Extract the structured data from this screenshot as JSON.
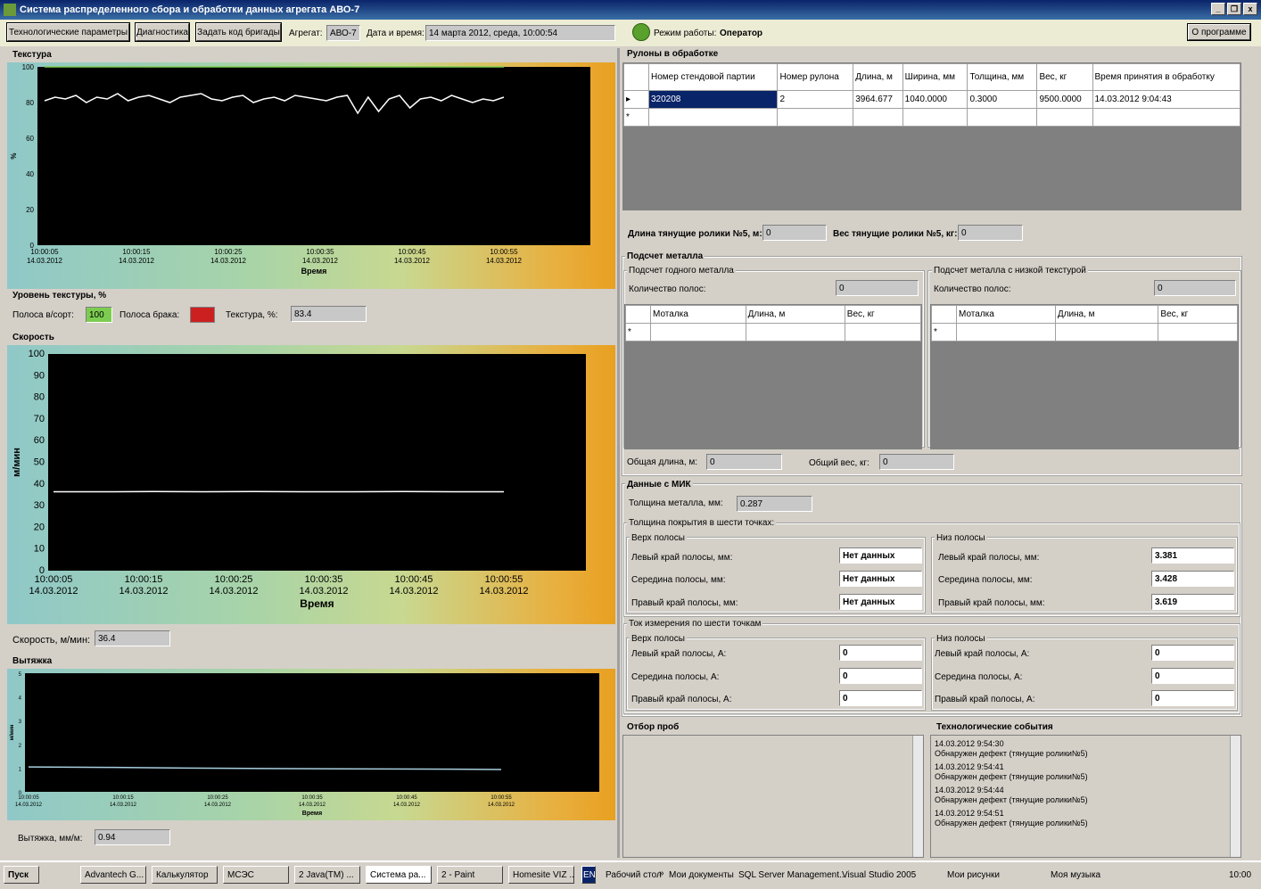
{
  "window": {
    "title": "Система распределенного сбора и обработки данных агрегата АВО-7",
    "min": "_",
    "max": "❒",
    "close": "x"
  },
  "toolbar": {
    "tech_params": "Технологические параметры",
    "diagnostics": "Диагностика",
    "brigade": "Задать код бригады",
    "aggregate_label": "Агрегат:",
    "aggregate_value": "АВО-7",
    "datetime_label": "Дата и время:",
    "datetime_value": "14 марта 2012, среда, 10:00:54",
    "mode_label": "Режим работы:",
    "mode_value": "Оператор",
    "about": "О программе"
  },
  "texture": {
    "title": "Текстура",
    "ylabel": "%",
    "xlabel": "Время",
    "level_title": "Уровень текстуры, %",
    "strip_grade_label": "Полоса в/сорт:",
    "strip_grade_value": "100",
    "defect_label": "Полоса брака:",
    "texture_label": "Текстура, %:",
    "texture_value": "83.4"
  },
  "speed": {
    "title": "Скорость",
    "ylabel": "м/мин",
    "xlabel": "Время",
    "speed_label": "Скорость, м/мин:",
    "speed_value": "36.4"
  },
  "stretch": {
    "title": "Вытяжка",
    "ylabel": "м/мин",
    "xlabel": "Время",
    "stretch_label": "Вытяжка, мм/м:",
    "stretch_value": "0.94"
  },
  "chart_data": [
    {
      "type": "line",
      "title": "Текстура",
      "ylabel": "%",
      "xlabel": "Время",
      "ylim": [
        0,
        100
      ],
      "yticks": [
        "0",
        "20",
        "40",
        "60",
        "80",
        "100"
      ],
      "xticks": [
        "10:00:05",
        "10:00:15",
        "10:00:25",
        "10:00:35",
        "10:00:45",
        "10:00:55"
      ],
      "xdate": "14.03.2012",
      "series": [
        {
          "values": [
            100,
            100
          ]
        },
        {
          "values": [
            81,
            83,
            82,
            84,
            80,
            83,
            82,
            85,
            81,
            83,
            84,
            82,
            80,
            83,
            84,
            85,
            82,
            81,
            83,
            84,
            80,
            82,
            83,
            81,
            84,
            83,
            82,
            81,
            83,
            84,
            74,
            83,
            75,
            82,
            84,
            77,
            82,
            83,
            81,
            84,
            82,
            80,
            82,
            81,
            83
          ]
        }
      ]
    },
    {
      "type": "line",
      "title": "Скорость",
      "ylabel": "м/мин",
      "xlabel": "Время",
      "ylim": [
        0,
        100
      ],
      "yticks": [
        "0",
        "10",
        "20",
        "30",
        "40",
        "50",
        "60",
        "70",
        "80",
        "90",
        "100"
      ],
      "xticks": [
        "10:00:05",
        "10:00:15",
        "10:00:25",
        "10:00:35",
        "10:00:45",
        "10:00:55"
      ],
      "xdate": "14.03.2012",
      "series": [
        {
          "values": [
            36.4,
            36.4,
            36.5,
            36.4,
            36.5,
            36.4,
            36.4,
            36.5,
            36.4,
            36.4
          ]
        }
      ]
    },
    {
      "type": "line",
      "title": "Вытяжка",
      "ylabel": "м/мин",
      "xlabel": "Время",
      "ylim": [
        0,
        5
      ],
      "yticks": [
        "0",
        "1",
        "2",
        "3",
        "4",
        "5"
      ],
      "xticks": [
        "10:00:05",
        "10:00:15",
        "10:00:25",
        "10:00:35",
        "10:00:45",
        "10:00:55"
      ],
      "xdate": "14.03.2012",
      "series": [
        {
          "values": [
            1.05,
            1.03,
            1.0,
            0.98,
            0.97,
            0.96,
            0.94
          ]
        }
      ]
    }
  ],
  "rolls": {
    "title": "Рулоны в обработке",
    "headers": [
      "Номер стендовой партии",
      "Номер рулона",
      "Длина, м",
      "Ширина, мм",
      "Толщина, мм",
      "Вес, кг",
      "Время принятия в обработку"
    ],
    "rows": [
      [
        "320208",
        "2",
        "3964.677",
        "1040.0000",
        "0.3000",
        "9500.0000",
        "14.03.2012 9:04:43"
      ]
    ]
  },
  "rollers": {
    "length_label": "Длина тянущие ролики №5, м:",
    "length_value": "0",
    "weight_label": "Вес тянущие ролики №5, кг:",
    "weight_value": "0"
  },
  "metal": {
    "title": "Подсчет металла",
    "good_title": "Подсчет годного металла",
    "low_title": "Подсчет металла с низкой текстурой",
    "count_label": "Количество полос:",
    "count_good": "0",
    "count_low": "0",
    "headers": [
      "Моталка",
      "Длина, м",
      "Вес, кг"
    ],
    "total_len_label": "Общая длина, м:",
    "total_len": "0",
    "total_w_label": "Общий вес, кг:",
    "total_w": "0"
  },
  "mik": {
    "title": "Данные с МИК",
    "thick_label": "Толщина металла, мм:",
    "thick_value": "0.287",
    "coat_title": "Толщина покрытия в  шести точках:",
    "top": "Верх полосы",
    "bottom": "Низ полосы",
    "left": "Левый край полосы, мм:",
    "mid": "Середина полосы, мм:",
    "right": "Правый край полосы, мм:",
    "top_vals": [
      "Нет данных",
      "Нет данных",
      "Нет данных"
    ],
    "bot_vals": [
      "3.381",
      "3.428",
      "3.619"
    ],
    "cur_title": "Ток измерения по шести точкам",
    "cleft": "Левый край полосы, А:",
    "cmid": "Середина полосы, А:",
    "cright": "Правый край полосы, А:",
    "ctop_vals": [
      "0",
      "0",
      "0"
    ],
    "cbot_vals": [
      "0",
      "0",
      "0"
    ]
  },
  "samples": {
    "title": "Отбор проб"
  },
  "events": {
    "title": "Технологические события",
    "items": [
      {
        "time": "14.03.2012 9:54:30",
        "text": "Обнаружен дефект (тянущие ролики№5)"
      },
      {
        "time": "14.03.2012 9:54:41",
        "text": "Обнаружен дефект (тянущие ролики№5)"
      },
      {
        "time": "14.03.2012 9:54:44",
        "text": "Обнаружен дефект (тянущие ролики№5)"
      },
      {
        "time": "14.03.2012 9:54:51",
        "text": "Обнаружен дефект (тянущие ролики№5)"
      }
    ]
  },
  "taskbar": {
    "start": "Пуск",
    "items": [
      "Advantech G...",
      "Калькулятор",
      "МСЭС",
      "2 Java(TM) ...",
      "Система ра...",
      "2 - Paint",
      "Homesite VIZ ..."
    ],
    "lang": "EN",
    "links": [
      "Рабочий стол",
      "»",
      "Мои документы",
      "SQL Server Management...",
      "Visual Studio 2005",
      "Мои рисунки",
      "Моя музыка"
    ],
    "clock": "10:00"
  },
  "colors": {
    "green_led": "#5aa02c",
    "defect": "#cc2020",
    "texture_ref": "#7ccc50"
  }
}
